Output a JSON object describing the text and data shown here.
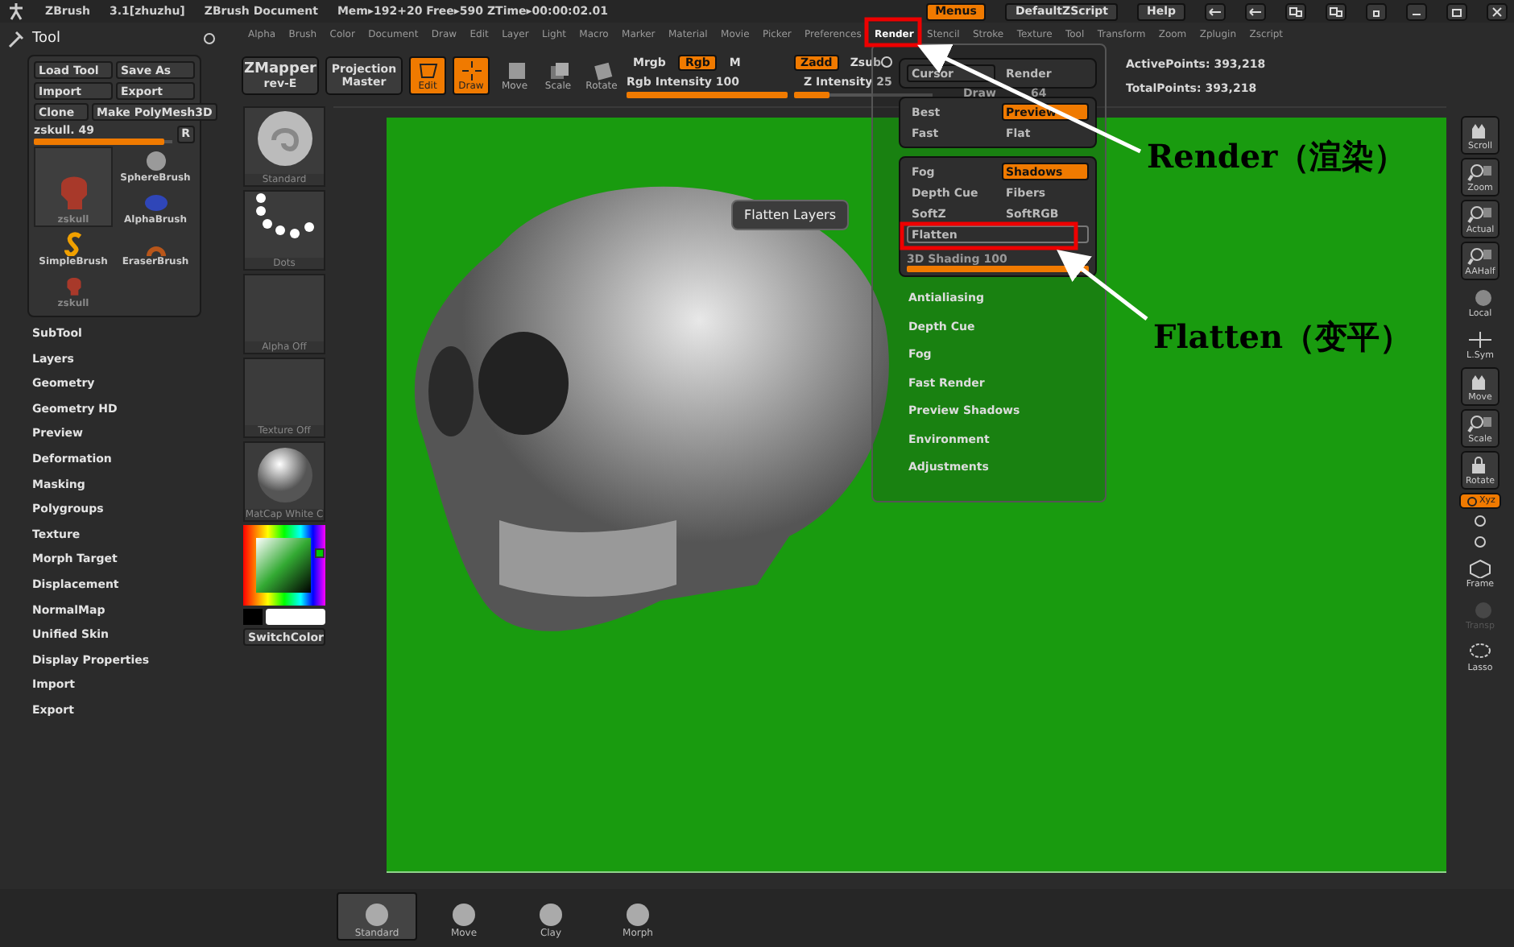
{
  "title_bar": {
    "app": "ZBrush",
    "version": "3.1[zhuzhu]",
    "document": "ZBrush Document",
    "stats": "Mem▸192+20 Free▸590 ZTime▸00:00:02.01"
  },
  "top_buttons": [
    {
      "label": "Menus",
      "selected": true
    },
    {
      "label": "DefaultZScript",
      "selected": false
    },
    {
      "label": "Help",
      "selected": false
    }
  ],
  "tool_panel": {
    "title": "Tool",
    "buttons": [
      "Load Tool",
      "Save As",
      "Import",
      "Export",
      "Clone",
      "Make PolyMesh3D"
    ],
    "slider": {
      "label": "zskull. 49",
      "level": 0.95
    },
    "reset": "R",
    "tools": [
      {
        "label": "zskull",
        "kind": "skull",
        "selected": true
      },
      {
        "label": "SimpleBrush",
        "kind": "simple",
        "selected": false
      },
      {
        "label": "zskull",
        "kind": "skull",
        "selected": false
      },
      {
        "label": "SphereBrush",
        "kind": "sphere",
        "selected": false
      },
      {
        "label": "AlphaBrush",
        "kind": "alpha",
        "selected": false
      },
      {
        "label": "EraserBrush",
        "kind": "eraser",
        "selected": false
      }
    ]
  },
  "palettes": [
    "SubTool",
    "Layers",
    "Geometry",
    "Geometry HD",
    "Preview",
    "Deformation",
    "Masking",
    "Polygroups",
    "Texture",
    "Morph Target",
    "Displacement",
    "NormalMap",
    "Unified Skin",
    "Display Properties",
    "Import",
    "Export"
  ],
  "menu_bar": [
    {
      "label": "Alpha",
      "selected": false
    },
    {
      "label": "Brush",
      "selected": false
    },
    {
      "label": "Color",
      "selected": false
    },
    {
      "label": "Document",
      "selected": false
    },
    {
      "label": "Draw",
      "selected": false
    },
    {
      "label": "Edit",
      "selected": false
    },
    {
      "label": "Layer",
      "selected": false
    },
    {
      "label": "Light",
      "selected": false
    },
    {
      "label": "Macro",
      "selected": false
    },
    {
      "label": "Marker",
      "selected": false
    },
    {
      "label": "Material",
      "selected": false
    },
    {
      "label": "Movie",
      "selected": false
    },
    {
      "label": "Picker",
      "selected": false
    },
    {
      "label": "Preferences",
      "selected": false
    },
    {
      "label": "Render",
      "selected": true
    },
    {
      "label": "Stencil",
      "selected": false
    },
    {
      "label": "Stroke",
      "selected": false
    },
    {
      "label": "Texture",
      "selected": false
    },
    {
      "label": "Tool",
      "selected": false
    },
    {
      "label": "Transform",
      "selected": false
    },
    {
      "label": "Zoom",
      "selected": false
    },
    {
      "label": "Zplugin",
      "selected": false
    },
    {
      "label": "Zscript",
      "selected": false
    }
  ],
  "toolbar": {
    "zmapper": [
      "ZMapper",
      "rev-E"
    ],
    "projection": [
      "Projection",
      "Master"
    ],
    "modes": [
      {
        "label": "Edit",
        "kind": "edit",
        "on": true
      },
      {
        "label": "Draw",
        "kind": "draw",
        "on": true
      },
      {
        "label": "Move",
        "kind": "move",
        "on": false
      },
      {
        "label": "Scale",
        "kind": "scale",
        "on": false
      },
      {
        "label": "Rotate",
        "kind": "rotate",
        "on": false
      }
    ],
    "rgb": [
      {
        "label": "Mrgb",
        "on": false
      },
      {
        "label": "Rgb",
        "on": true
      },
      {
        "label": "M",
        "on": false
      }
    ],
    "rgb_intensity": {
      "label": "Rgb Intensity 100",
      "level": 1
    },
    "z": [
      {
        "label": "Zadd",
        "on": true
      },
      {
        "label": "Zsub",
        "on": false
      }
    ],
    "z_intensity": {
      "label": "Z Intensity 25",
      "level": 0.25
    },
    "draw_size": [
      "Draw",
      "64"
    ],
    "active_points": "ActivePoints: 393,218",
    "total_points": "TotalPoints: 393,218"
  },
  "shelf": {
    "thumbs": [
      {
        "label": "Standard",
        "kind": "brush"
      },
      {
        "label": "Dots",
        "kind": "dots"
      },
      {
        "label": "Alpha Off",
        "kind": "empty"
      },
      {
        "label": "Texture Off",
        "kind": "empty"
      },
      {
        "label": "MatCap White C",
        "kind": "sphere"
      }
    ],
    "switch_color": "SwitchColor"
  },
  "tooltip": "Flatten Layers",
  "render_menu": {
    "pairs": [
      [
        {
          "label": "Cursor",
          "on": false
        },
        {
          "label": "Render",
          "on": false
        }
      ],
      [
        {
          "label": "Best",
          "on": false
        },
        {
          "label": "Preview",
          "on": true
        }
      ],
      [
        {
          "label": "Fast",
          "on": false
        },
        {
          "label": "Flat",
          "on": false
        }
      ],
      [
        {
          "label": "Fog",
          "on": false
        },
        {
          "label": "Shadows",
          "on": true
        }
      ],
      [
        {
          "label": "Depth Cue",
          "on": false
        },
        {
          "label": "Fibers",
          "on": false
        }
      ],
      [
        {
          "label": "SoftZ",
          "on": false
        },
        {
          "label": "SoftRGB",
          "on": false
        }
      ]
    ],
    "flatten": "Flatten",
    "shading": {
      "label": "3D Shading 100",
      "level": 1
    },
    "sections": [
      "Antialiasing",
      "Depth Cue",
      "Fog",
      "Fast Render",
      "Preview Shadows",
      "Environment",
      "Adjustments"
    ]
  },
  "right_toolbar": [
    {
      "label": "Scroll",
      "kind": "hand",
      "selected": false,
      "disabled": false
    },
    {
      "label": "Zoom",
      "kind": "zoom",
      "selected": false,
      "disabled": false
    },
    {
      "label": "Actual",
      "kind": "zoom",
      "selected": false,
      "disabled": false
    },
    {
      "label": "AAHalf",
      "kind": "zoom",
      "selected": false,
      "disabled": false
    },
    {
      "label": "Local",
      "kind": "plain",
      "selected": false,
      "disabled": false
    },
    {
      "label": "L.Sym",
      "kind": "sym",
      "selected": false,
      "disabled": false
    },
    {
      "label": "Move",
      "kind": "hand",
      "selected": false,
      "disabled": false
    },
    {
      "label": "Scale",
      "kind": "zoom",
      "selected": false,
      "disabled": false
    },
    {
      "label": "Rotate",
      "kind": "lock",
      "selected": false,
      "disabled": false
    },
    {
      "label": "Xyz",
      "kind": "axis",
      "selected": true,
      "disabled": false
    },
    {
      "kind": "axis_y",
      "selected": false,
      "disabled": false
    },
    {
      "kind": "axis_z",
      "selected": false,
      "disabled": false
    },
    {
      "label": "Frame",
      "kind": "cube",
      "selected": false,
      "disabled": false
    },
    {
      "label": "Transp",
      "kind": "plain",
      "selected": false,
      "disabled": true
    },
    {
      "label": "Lasso",
      "kind": "lasso",
      "selected": false,
      "disabled": false
    }
  ],
  "bottom_brushes": [
    {
      "label": "Standard",
      "selected": true
    },
    {
      "label": "Move",
      "selected": false
    },
    {
      "label": "Clay",
      "selected": false
    },
    {
      "label": "Morph",
      "selected": false
    }
  ],
  "annotations": [
    "Render（渲染）",
    "Flatten（变平）"
  ]
}
